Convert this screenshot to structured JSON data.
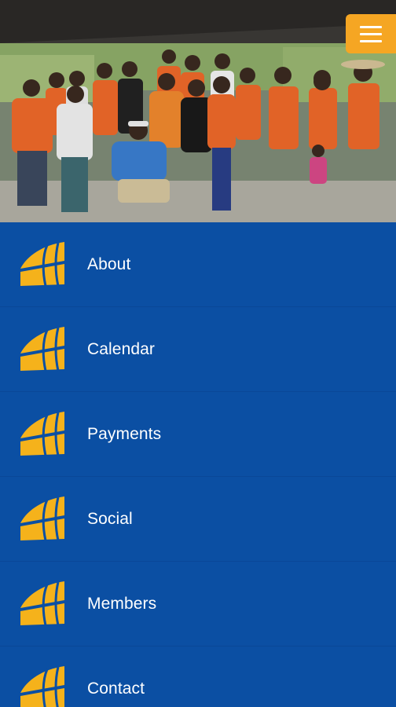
{
  "header": {
    "photo_name": "group-photo",
    "menu_button_icon": "hamburger-icon"
  },
  "colors": {
    "primary_blue": "#0b4fa3",
    "accent_orange": "#f5a623",
    "icon_gold": "#f5b21b",
    "text_white": "#ffffff"
  },
  "menu": {
    "items": [
      {
        "label": "About",
        "icon": "sail-logo-icon"
      },
      {
        "label": "Calendar",
        "icon": "sail-logo-icon"
      },
      {
        "label": "Payments",
        "icon": "sail-logo-icon"
      },
      {
        "label": "Social",
        "icon": "sail-logo-icon"
      },
      {
        "label": "Members",
        "icon": "sail-logo-icon"
      },
      {
        "label": "Contact",
        "icon": "sail-logo-icon"
      }
    ]
  }
}
